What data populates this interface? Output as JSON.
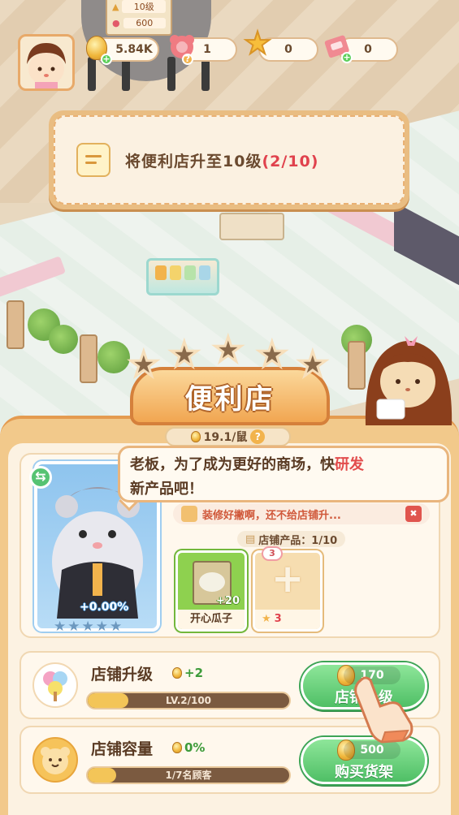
{
  "top_bar": {
    "sign_level": "10级",
    "sign_cost": "600",
    "coins": "5.84K",
    "gems": "1",
    "stars": "0",
    "tickets": "0"
  },
  "task": {
    "text": "将便利店升至10级",
    "progress": "(2/10)"
  },
  "shop": {
    "title": "便利店",
    "star_count": 5,
    "rate": "19.1/鼠",
    "help": "?",
    "manager_bonus": "+0.00%",
    "speech_a": "老板，为了成为更好的商场，快",
    "speech_hl": "研发",
    "speech_b": "新产品吧！",
    "complaint": "装修好撇啊，还不给店铺升...",
    "products_label": "店铺产品：1/10",
    "product1_name": "开心瓜子",
    "product1_count": "+20",
    "product2_top_cost": "3",
    "product2_cost": "3"
  },
  "upgrade": {
    "title": "店铺升级",
    "bonus": "+2",
    "level_text": "LV.2/100",
    "level_progress": 0.2,
    "btn_cost": "170",
    "btn_label": "店铺升级"
  },
  "capacity": {
    "title": "店铺容量",
    "bonus": "0%",
    "bar_text": "1/7名顾客",
    "progress": 0.14,
    "btn_cost": "500",
    "btn_label": "购买货架"
  },
  "colors": {
    "accent_orange": "#e49b50",
    "green_button": "#4fbf66",
    "highlight_red": "#e24c4c"
  }
}
